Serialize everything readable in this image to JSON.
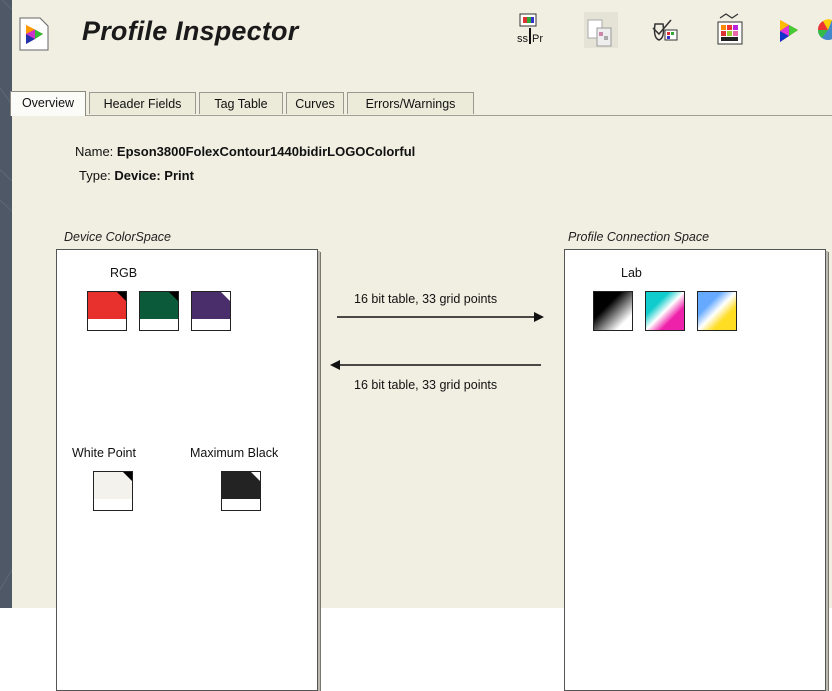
{
  "app": {
    "title": "Profile Inspector"
  },
  "toolbar": {
    "icons": [
      "ssPr-icon",
      "document-icon",
      "measure-icon",
      "compare-icon",
      "gamut-icon",
      "color-wheel-icon"
    ]
  },
  "tabs": [
    {
      "label": "Overview",
      "active": true
    },
    {
      "label": "Header Fields",
      "active": false
    },
    {
      "label": "Tag Table",
      "active": false
    },
    {
      "label": "Curves",
      "active": false
    },
    {
      "label": "Errors/Warnings",
      "active": false
    }
  ],
  "profile": {
    "name_label": "Name:",
    "name_value": "Epson3800FolexContour1440bidirLOGOColorful",
    "type_label": "Type:",
    "type_value": "Device: Print"
  },
  "device": {
    "group_label": "Device ColorSpace",
    "space": "RGB",
    "swatches": [
      "#e8312d",
      "#0b5a3a",
      "#4a2e6b"
    ],
    "white_point_label": "White Point",
    "white_point_color": "#f3f2ec",
    "max_black_label": "Maximum Black",
    "max_black_color": "#232323"
  },
  "arrows": {
    "forward_label": "16 bit table, 33 grid points",
    "reverse_label": "16 bit table, 33 grid points"
  },
  "pcs": {
    "group_label": "Profile Connection Space",
    "space": "Lab"
  },
  "colors": {
    "background": "#4e5866",
    "window": "#f1efe2"
  }
}
